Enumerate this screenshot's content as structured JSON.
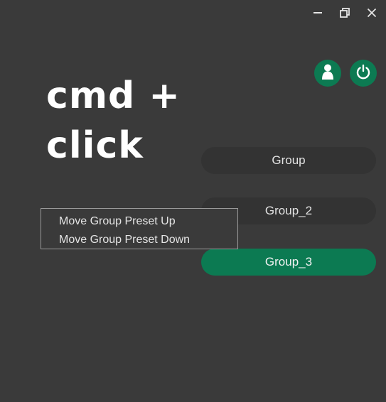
{
  "theme": {
    "accent": "#0c7a52",
    "background": "#3a3a3a",
    "pill_background": "#333333"
  },
  "window_controls": {
    "minimize_icon": "minimize-icon",
    "restore_icon": "restore-icon",
    "close_icon": "close-icon"
  },
  "header_buttons": {
    "user_icon": "user-icon",
    "power_icon": "power-icon"
  },
  "overlay": {
    "line1": "cmd +",
    "line2": "click"
  },
  "groups": [
    {
      "label": "Group",
      "active": false
    },
    {
      "label": "Group_2",
      "active": false
    },
    {
      "label": "Group_3",
      "active": true
    }
  ],
  "context_menu": {
    "items": [
      {
        "label": "Move Group Preset Up"
      },
      {
        "label": "Move Group Preset Down"
      }
    ]
  }
}
